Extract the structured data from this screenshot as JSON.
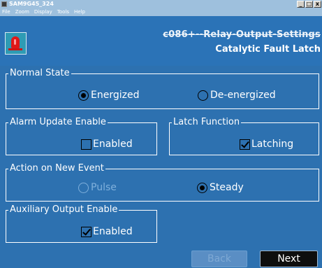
{
  "window": {
    "title": "SAM9G45_324",
    "buttons": {
      "minimize": "_",
      "restore": "□",
      "close": "x"
    }
  },
  "menu": {
    "items": [
      "File",
      "Zoom",
      "Display",
      "Tools",
      "Help"
    ]
  },
  "header": {
    "line1": "c086+--Relay-Output-Settings",
    "line2": "Catalytic Fault Latch"
  },
  "normal_state": {
    "label": "Normal State",
    "energized": "Energized",
    "deenergized": "De-energized",
    "selected": "Energized"
  },
  "alarm_update": {
    "label": "Alarm Update Enable",
    "option": "Enabled",
    "checked": false
  },
  "latch_function": {
    "label": "Latch Function",
    "option": "Latching",
    "checked": true
  },
  "action_new_event": {
    "label": "Action on New Event",
    "pulse": "Pulse",
    "steady": "Steady",
    "selected": "Steady"
  },
  "aux_output": {
    "label": "Auxiliary Output Enable",
    "option": "Enabled",
    "checked": true
  },
  "nav": {
    "back": "Back",
    "next": "Next"
  }
}
